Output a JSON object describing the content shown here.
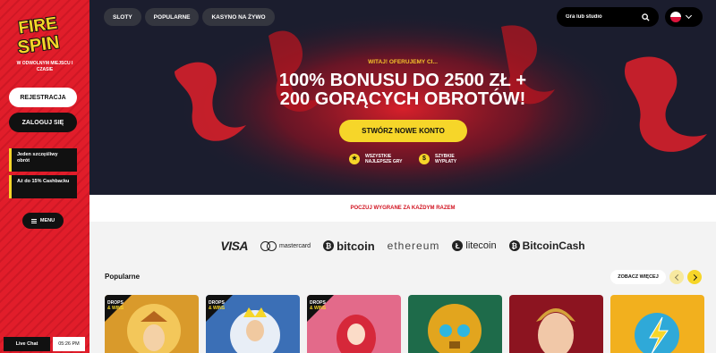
{
  "brand": {
    "logo_text_1": "FIRE",
    "logo_text_2": "SPIN",
    "tagline": "W ODWOLNYM MIEJSCU I CZASIE"
  },
  "sidebar": {
    "register_label": "REJESTRACJA",
    "login_label": "ZALOGUJ SIĘ",
    "promos": [
      {
        "text": "Jeden szczęśliwy obrót"
      },
      {
        "text": "Aż do 15% Cashbacku"
      }
    ],
    "menu_label": "MENU",
    "menu_icon": "hamburger-icon",
    "live_chat_label": "Live Chat",
    "clock": "05:26 PM"
  },
  "nav": {
    "tabs": [
      {
        "label": "SLOTY"
      },
      {
        "label": "POPULARNE"
      },
      {
        "label": "KASYNO NA ŻYWO"
      }
    ],
    "search_placeholder": "Gra lub studio",
    "search_icon": "search-icon",
    "language_icon": "poland-flag-icon"
  },
  "hero": {
    "welcome": "WITAJ! OFERUJEMY CI...",
    "headline_line1": "100% BONUSU DO 2500 ZŁ +",
    "headline_line2": "200 GORĄCYCH OBROTÓW!",
    "cta_label": "STWÓRZ NOWE KONTO",
    "features": [
      {
        "line1": "WSZYSTKIE",
        "line2": "NAJLEPSZE GRY",
        "icon": "games-icon"
      },
      {
        "line1": "SZYBKIE",
        "line2": "WYPŁATY",
        "icon": "payout-icon"
      }
    ]
  },
  "banner": {
    "text": "POCZUJ WYGRANE ZA KAŻDYM RAZEM"
  },
  "payments": {
    "visa": "VISA",
    "mastercard": "mastercard",
    "bitcoin": "bitcoin",
    "ethereum": "ethereum",
    "litecoin": "litecoin",
    "bitcoincash": "BitcoinCash"
  },
  "popular": {
    "title": "Popularne",
    "see_more_label": "ZOBACZ WIĘCEJ",
    "badge_text_1": "DROPS",
    "badge_text_2": "& WINS"
  },
  "colors": {
    "accent_yellow": "#f6d629",
    "brand_red": "#e11d2a",
    "dark": "#1b1d2e"
  }
}
